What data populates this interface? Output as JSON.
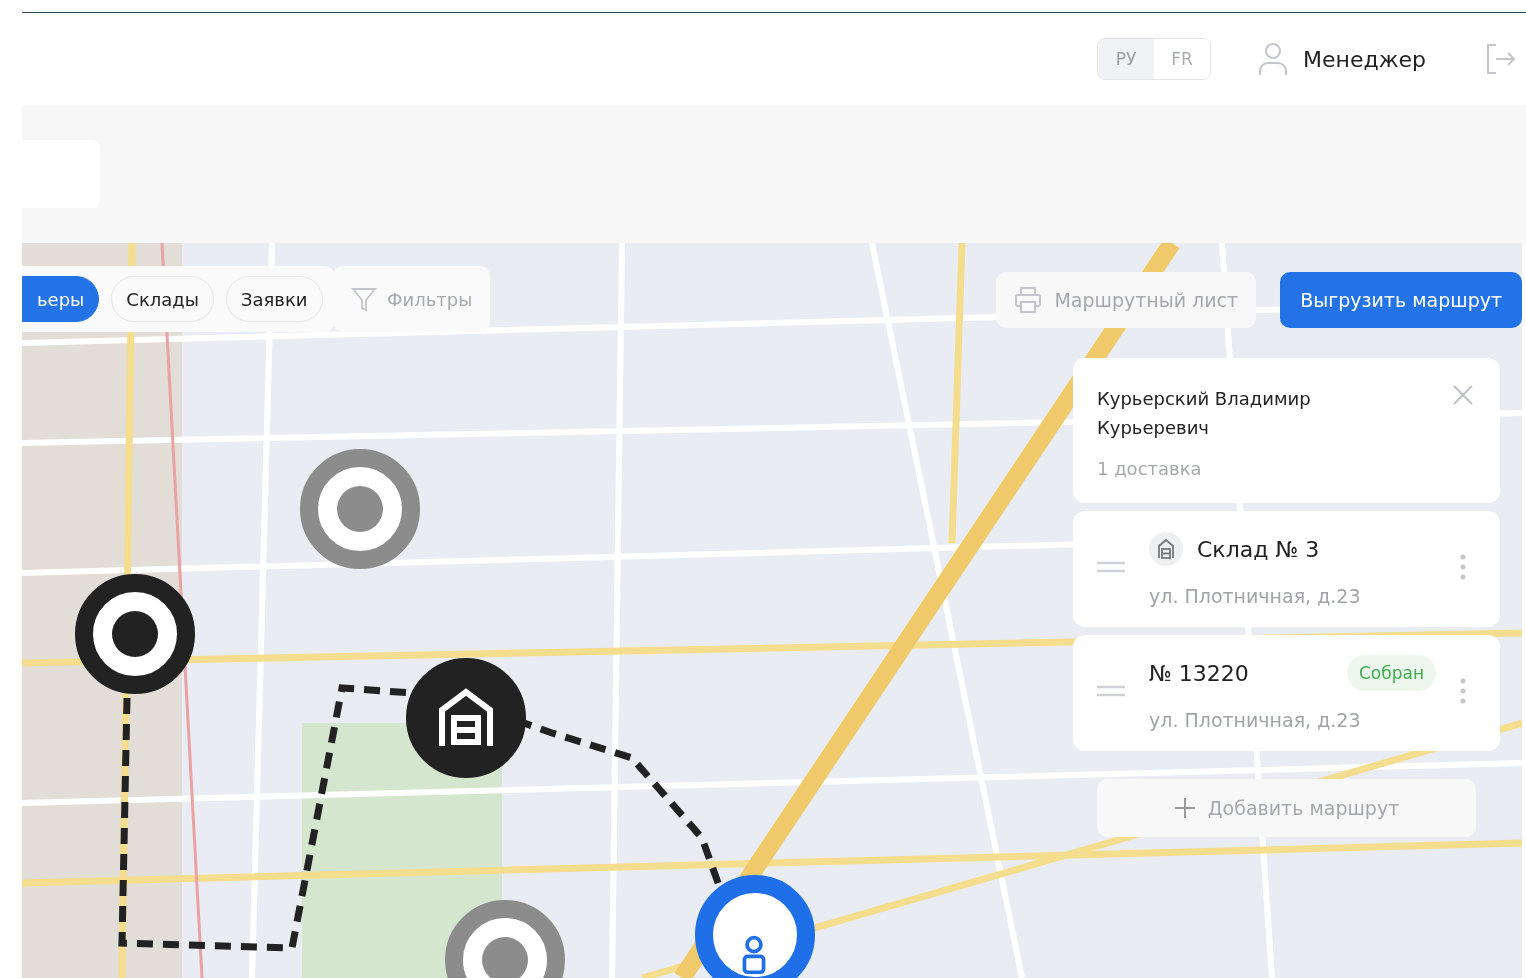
{
  "header": {
    "languages": [
      {
        "label": "РУ",
        "selected": true
      },
      {
        "label": "FR",
        "selected": false
      }
    ],
    "user": "Менеджер"
  },
  "map": {
    "layer_tabs": [
      {
        "label": "ьеры",
        "selected": true
      },
      {
        "label": "Склады",
        "selected": false
      },
      {
        "label": "Заявки",
        "selected": false
      }
    ],
    "filters_button": "Фильтры",
    "route_sheet_button": "Маршрутный лист",
    "export_button": "Выгрузить маршрут",
    "markers": [
      {
        "kind": "point",
        "selected": false
      },
      {
        "kind": "point",
        "selected": true
      },
      {
        "kind": "warehouse"
      },
      {
        "kind": "point",
        "selected": false
      },
      {
        "kind": "courier"
      }
    ]
  },
  "route_panel": {
    "courier": {
      "name": "Курьерский Владимир Курьеревич",
      "deliveries": "1 доставка"
    },
    "stops": [
      {
        "kind": "warehouse",
        "title": "Склад № 3",
        "address": "ул. Плотничная, д.23"
      },
      {
        "kind": "order",
        "title": "№ 13220",
        "status": "Собран",
        "address": "ул. Плотничная, д.23"
      }
    ],
    "add_button": "Добавить маршрут"
  }
}
